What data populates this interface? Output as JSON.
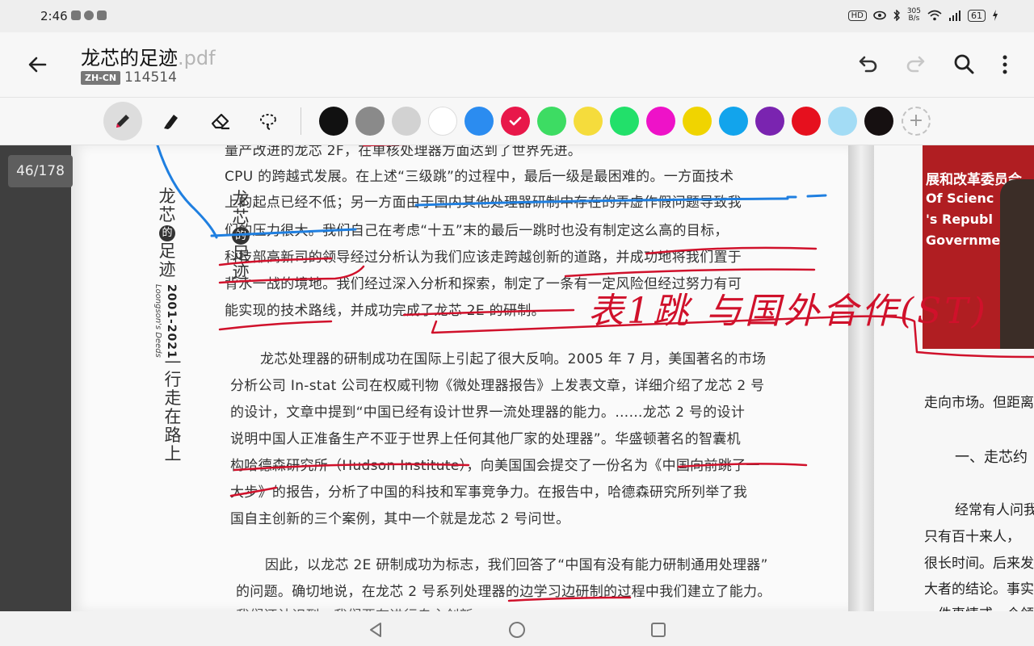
{
  "status": {
    "time": "2:46",
    "net_speed": "305\nB/s",
    "net_speed_top": "305",
    "net_speed_bottom": "B/s",
    "battery": "61",
    "hd": "HD"
  },
  "document": {
    "title": "龙芯的足迹",
    "ext": ".pdf",
    "language_badge": "ZH-CN",
    "id": "114514"
  },
  "toolbar": {
    "tools": [
      "pen-icon",
      "highlighter-icon",
      "eraser-icon",
      "lasso-icon"
    ],
    "colors": [
      "#111111",
      "#8a8a8a",
      "#d2d2d2",
      "#ffffff",
      "#2b8cf0",
      "#e8184a",
      "#3ddc63",
      "#f5dc3c",
      "#22e06a",
      "#ee12c8",
      "#f0d400",
      "#12a4ec",
      "#7a24b0",
      "#e6101e",
      "#a3dcf5",
      "#161011"
    ],
    "selected_color": "#e8184a"
  },
  "viewer": {
    "page_indicator": "46/178"
  },
  "page_left": {
    "side_title": [
      "龙",
      "芯",
      "的",
      "足",
      "迹"
    ],
    "side_subtitle": "Loongson's Deeds",
    "side_years": "2001-2021",
    "side_section": [
      "—",
      "行",
      "走",
      "在",
      "路",
      "上"
    ],
    "lines": [
      "量产改进的龙芯 2F，在单核处理器方面达到了世界先进。",
      "CPU 的跨越式发展。在上述“三级跳”的过程中，最后一级是最困难的。一方面技术",
      "上的起点已经不低；另一方面由于国内其他处理器研制中存在的弄虚作假问题导致我",
      "们的压力很大。我们自己在考虑“十五”末的最后一跳时也没有制定这么高的目标，",
      "科技部高新司的领导经过分析认为我们应该走跨越创新的道路，并成功地将我们置于",
      "背水一战的境地。我们经过深入分析和探索，制定了一条有一定风险但经过努力有可",
      "能实现的技术路线，并成功完成了龙芯 2E 的研制。",
      "龙芯处理器的研制成功在国际上引起了很大反响。2005 年 7 月，美国著名的市场",
      "分析公司 In-stat 公司在权威刊物《微处理器报告》上发表文章，详细介绍了龙芯 2 号",
      "的设计，文章中提到“中国已经有设计世界一流处理器的能力。……龙芯 2 号的设计",
      "说明中国人正准备生产不亚于世界上任何其他厂家的处理器”。华盛顿著名的智囊机",
      "构哈德森研究所（Hudson Institute），向美国国会提交了一份名为《中国向前跳了一",
      "大步》的报告，分析了中国的科技和军事竞争力。在报告中，哈德森研究所列举了我",
      "国自主创新的三个案例，其中一个就是龙芯 2 号问世。",
      "因此，以龙芯 2E 研制成功为标志，我们回答了“中国有没有能力研制通用处理器”",
      "的问题。确切地说，在龙芯 2 号系列处理器的边学习边研制的过程中我们建立了能力。",
      "我们还认识到，我们要有进行自主创新"
    ],
    "handwriting": "表1跳 与国外合作(ST)"
  },
  "page_right": {
    "photo_lines": [
      "展和改革委员会",
      "Of Scienc",
      "'s Republ",
      "Governme"
    ],
    "lines": [
      "走向市场。但距离",
      "一、走芯约",
      "经常有人问我",
      "只有百十来人，",
      "很长时间。后来发",
      "大者的结论。事实",
      "一件事情或一个领"
    ]
  }
}
